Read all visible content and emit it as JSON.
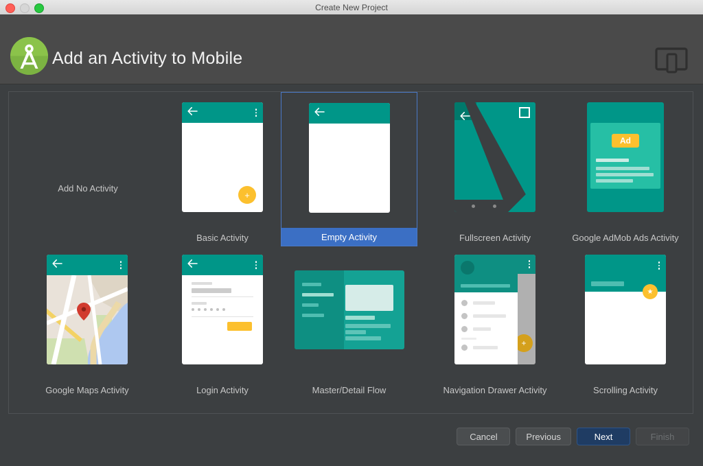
{
  "window": {
    "title": "Create New Project",
    "traffic_lights": [
      "close",
      "minimize",
      "maximize"
    ]
  },
  "header": {
    "title": "Add an Activity to Mobile",
    "logo_icon": "android-studio-logo-icon",
    "device_icon": "device-form-factor-icon",
    "accent_green": "#7cb342",
    "background": "#4a4a4a"
  },
  "templates": [
    {
      "id": "no-activity",
      "label": "Add No Activity",
      "thumb": "none",
      "selected": false
    },
    {
      "id": "basic-activity",
      "label": "Basic Activity",
      "thumb": "phone-appbar-fab",
      "selected": false
    },
    {
      "id": "empty-activity",
      "label": "Empty Activity",
      "thumb": "phone-appbar-plain",
      "selected": true
    },
    {
      "id": "fullscreen-activity",
      "label": "Fullscreen Activity",
      "thumb": "phone-fullscreen",
      "selected": false
    },
    {
      "id": "admob-activity",
      "label": "Google AdMob Ads Activity",
      "thumb": "phone-admob",
      "selected": false,
      "badge_text": "Ad"
    },
    {
      "id": "maps-activity",
      "label": "Google Maps Activity",
      "thumb": "phone-map",
      "selected": false
    },
    {
      "id": "login-activity",
      "label": "Login Activity",
      "thumb": "phone-login",
      "selected": false
    },
    {
      "id": "master-detail-flow",
      "label": "Master/Detail Flow",
      "thumb": "tablet-master-detail",
      "selected": false
    },
    {
      "id": "navigation-drawer-activity",
      "label": "Navigation Drawer Activity",
      "thumb": "phone-nav-drawer",
      "selected": false
    },
    {
      "id": "scrolling-activity",
      "label": "Scrolling Activity",
      "thumb": "phone-scrolling",
      "selected": false
    }
  ],
  "footer": {
    "cancel": "Cancel",
    "previous": "Previous",
    "next": "Next",
    "finish": "Finish",
    "next_is_default": true,
    "finish_disabled": true
  },
  "colors": {
    "selection_blue": "#3b6fc4",
    "selection_border": "#4a79c8",
    "material_teal": "#009688",
    "material_teal_dark": "#0e8f82",
    "material_teal_light": "#26bfa5",
    "accent_amber": "#fcc02e",
    "panel_bg": "#3c3f41",
    "header_bg": "#4a4a4a"
  }
}
